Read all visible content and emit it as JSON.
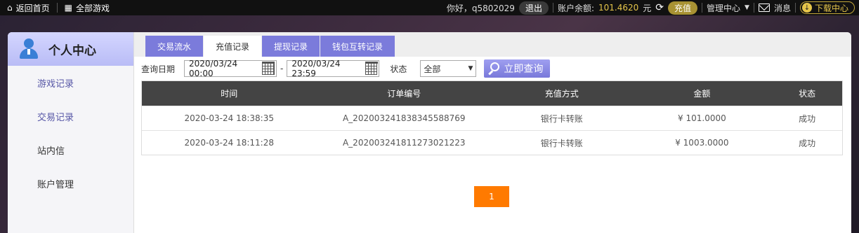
{
  "topbar": {
    "home_label": "返回首页",
    "all_games_label": "全部游戏",
    "greeting": "你好，q5802029",
    "logout_label": "退出",
    "balance_label": "账户余额:",
    "balance_value": "101.4620",
    "balance_unit": "元",
    "recharge_label": "充值",
    "manage_label": "管理中心",
    "message_label": "消息",
    "download_label": "下载中心"
  },
  "sidebar": {
    "title": "个人中心",
    "items": [
      {
        "label": "游戏记录"
      },
      {
        "label": "交易记录"
      },
      {
        "label": "站内信"
      },
      {
        "label": "账户管理"
      }
    ]
  },
  "tabs": [
    {
      "label": "交易流水"
    },
    {
      "label": "充值记录"
    },
    {
      "label": "提现记录"
    },
    {
      "label": "钱包互转记录"
    }
  ],
  "filter": {
    "date_label": "查询日期",
    "start_date": "2020/03/24 00:00",
    "separator": "-",
    "end_date": "2020/03/24 23:59",
    "status_label": "状态",
    "status_value": "全部",
    "query_label": "立即查询"
  },
  "table": {
    "headers": [
      "时间",
      "订单编号",
      "充值方式",
      "金额",
      "状态"
    ],
    "rows": [
      [
        "2020-03-24 18:38:35",
        "A_202003241838345588769",
        "银行卡转账",
        "¥ 101.0000",
        "成功"
      ],
      [
        "2020-03-24 18:11:28",
        "A_202003241811273021223",
        "银行卡转账",
        "¥ 1003.0000",
        "成功"
      ]
    ]
  },
  "pagination": {
    "current": "1"
  },
  "colors": {
    "accent": "#7b7bdb",
    "pager": "#ff7a00",
    "header": "#444444"
  }
}
